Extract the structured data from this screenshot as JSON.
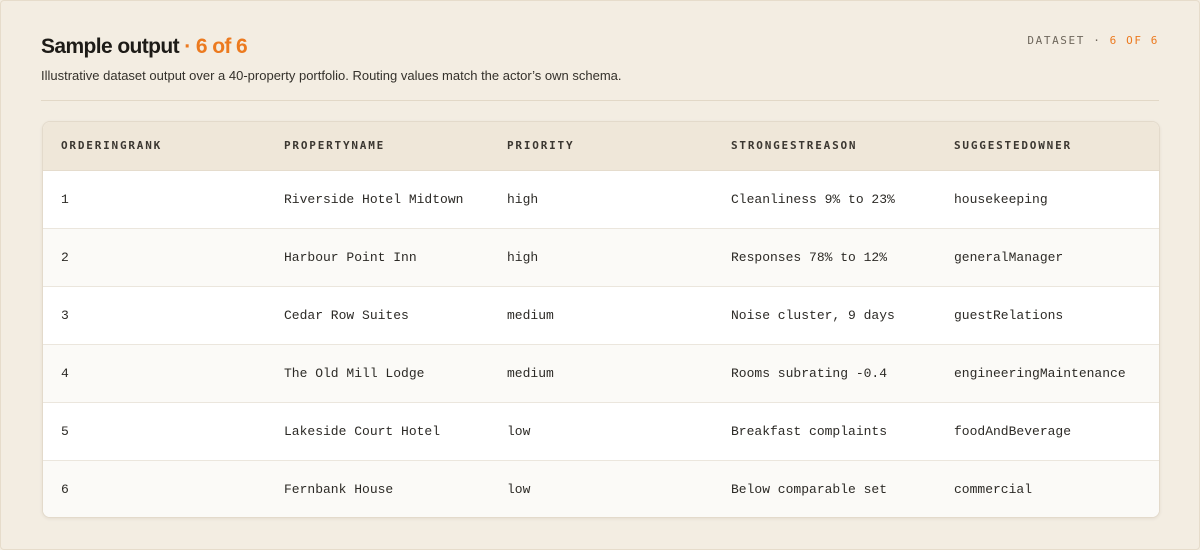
{
  "header": {
    "title": "Sample output",
    "title_accent": " · 6 of 6",
    "subtitle": "Illustrative dataset output over a 40-property portfolio. Routing values match the actor’s own schema.",
    "meta_label": "DATASET · ",
    "meta_value": "6 OF 6"
  },
  "colors": {
    "accent": "#ec7a1f",
    "background": "#f3ede2",
    "table_header_bg": "#efe7d9"
  },
  "table": {
    "columns": [
      "ORDERINGRANK",
      "PROPERTYNAME",
      "PRIORITY",
      "STRONGESTREASON",
      "SUGGESTEDOWNER"
    ],
    "rows": [
      [
        "1",
        "Riverside Hotel Midtown",
        "high",
        "Cleanliness 9% to 23%",
        "housekeeping"
      ],
      [
        "2",
        "Harbour Point Inn",
        "high",
        "Responses 78% to 12%",
        "generalManager"
      ],
      [
        "3",
        "Cedar Row Suites",
        "medium",
        "Noise cluster, 9 days",
        "guestRelations"
      ],
      [
        "4",
        "The Old Mill Lodge",
        "medium",
        "Rooms subrating -0.4",
        "engineeringMaintenance"
      ],
      [
        "5",
        "Lakeside Court Hotel",
        "low",
        "Breakfast complaints",
        "foodAndBeverage"
      ],
      [
        "6",
        "Fernbank House",
        "low",
        "Below comparable set",
        "commercial"
      ]
    ]
  }
}
